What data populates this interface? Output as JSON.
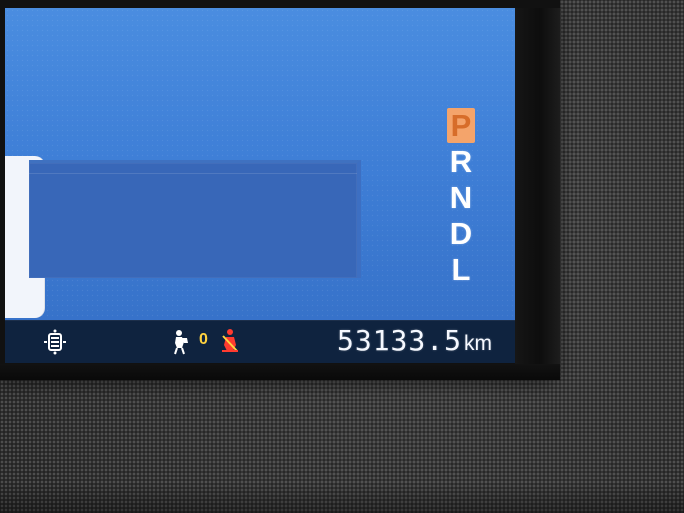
{
  "instrument_cluster": {
    "gear_selector": {
      "letters": [
        "P",
        "R",
        "N",
        "D",
        "L"
      ],
      "selected": "P"
    },
    "status_bar": {
      "odometer_value": "53133.5",
      "odometer_unit": "km",
      "passenger_count": "0"
    },
    "colors": {
      "screen_blue": "#3e7ed6",
      "panel_blue": "#3867b8",
      "status_bar": "#0f233f",
      "gear_highlight": "#f4a46b",
      "warning_red": "#ff3b2f",
      "warning_yellow": "#ffd23f"
    },
    "icons": {
      "tire_pressure": "tire-pressure-icon",
      "passenger_airbag": "passenger-airbag-icon",
      "seatbelt_warning": "seatbelt-warning-icon"
    }
  }
}
